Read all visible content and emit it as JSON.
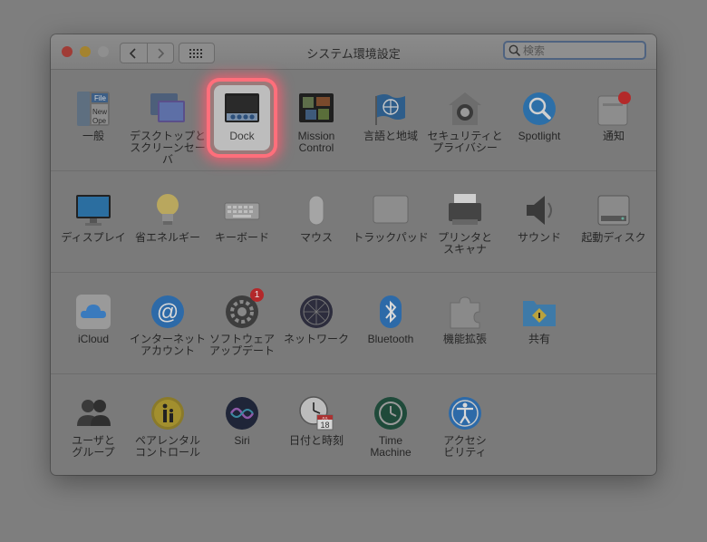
{
  "window": {
    "title": "システム環境設定"
  },
  "search": {
    "placeholder": "検索"
  },
  "rows": [
    [
      {
        "name": "general",
        "label": "一般",
        "icon": "general-icon"
      },
      {
        "name": "desktop-screensaver",
        "label": "デスクトップと\nスクリーンセーバ",
        "icon": "desktop-screensaver-icon"
      },
      {
        "name": "dock",
        "label": "Dock",
        "icon": "dock-icon",
        "highlight": true
      },
      {
        "name": "mission-control",
        "label": "Mission\nControl",
        "icon": "mission-control-icon"
      },
      {
        "name": "language-region",
        "label": "言語と地域",
        "icon": "flag-globe-icon"
      },
      {
        "name": "security-privacy",
        "label": "セキュリティと\nプライバシー",
        "icon": "house-lock-icon"
      },
      {
        "name": "spotlight",
        "label": "Spotlight",
        "icon": "magnifier-icon"
      },
      {
        "name": "notifications",
        "label": "通知",
        "icon": "notifications-icon"
      }
    ],
    [
      {
        "name": "displays",
        "label": "ディスプレイ",
        "icon": "monitor-icon"
      },
      {
        "name": "energy-saver",
        "label": "省エネルギー",
        "icon": "lightbulb-icon"
      },
      {
        "name": "keyboard",
        "label": "キーボード",
        "icon": "keyboard-icon"
      },
      {
        "name": "mouse",
        "label": "マウス",
        "icon": "mouse-icon"
      },
      {
        "name": "trackpad",
        "label": "トラックパッド",
        "icon": "trackpad-icon"
      },
      {
        "name": "printers-scanners",
        "label": "プリンタと\nスキャナ",
        "icon": "printer-icon"
      },
      {
        "name": "sound",
        "label": "サウンド",
        "icon": "speaker-icon"
      },
      {
        "name": "startup-disk",
        "label": "起動ディスク",
        "icon": "hard-drive-icon"
      }
    ],
    [
      {
        "name": "icloud",
        "label": "iCloud",
        "icon": "cloud-icon"
      },
      {
        "name": "internet-accounts",
        "label": "インターネット\nアカウント",
        "icon": "at-sign-icon"
      },
      {
        "name": "software-update",
        "label": "ソフトウェア\nアップデート",
        "icon": "gear-icon",
        "badge": "1"
      },
      {
        "name": "network",
        "label": "ネットワーク",
        "icon": "network-globe-icon"
      },
      {
        "name": "bluetooth",
        "label": "Bluetooth",
        "icon": "bluetooth-icon"
      },
      {
        "name": "extensions",
        "label": "機能拡張",
        "icon": "puzzle-icon"
      },
      {
        "name": "sharing",
        "label": "共有",
        "icon": "shared-folder-icon"
      }
    ],
    [
      {
        "name": "users-groups",
        "label": "ユーザと\nグループ",
        "icon": "users-icon"
      },
      {
        "name": "parental-controls",
        "label": "ペアレンタル\nコントロール",
        "icon": "parental-icon"
      },
      {
        "name": "siri",
        "label": "Siri",
        "icon": "siri-icon"
      },
      {
        "name": "date-time",
        "label": "日付と時刻",
        "icon": "clock-calendar-icon",
        "calendar_month": "JUL",
        "calendar_day": "18"
      },
      {
        "name": "time-machine",
        "label": "Time\nMachine",
        "icon": "time-machine-icon"
      },
      {
        "name": "accessibility",
        "label": "アクセシ\nビリティ",
        "icon": "accessibility-icon"
      }
    ]
  ]
}
